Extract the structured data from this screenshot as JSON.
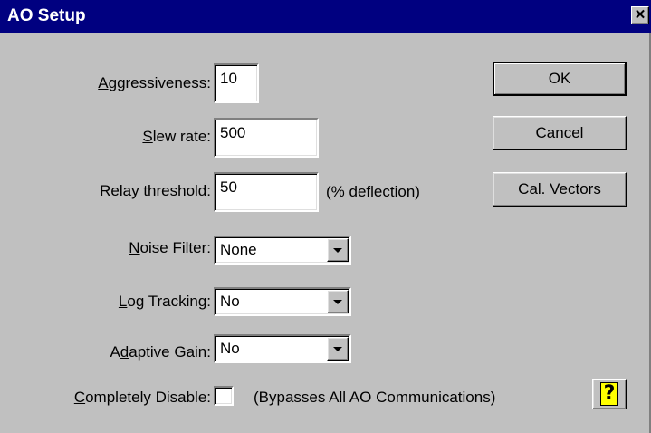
{
  "dialog": {
    "title": "AO Setup",
    "close_glyph": "✕"
  },
  "fields": {
    "aggressiveness": {
      "label_accel": "A",
      "label_rest": "ggressiveness:",
      "value": "10"
    },
    "slew_rate": {
      "label_accel": "S",
      "label_rest": "lew rate:",
      "value": "500"
    },
    "relay_threshold": {
      "label_accel": "R",
      "label_rest": "elay threshold:",
      "value": "50",
      "unit_note": "(% deflection)"
    },
    "noise_filter": {
      "label_accel": "N",
      "label_rest": "oise Filter:",
      "value": "None"
    },
    "log_tracking": {
      "label_accel": "L",
      "label_rest": "og Tracking:",
      "value": "No"
    },
    "adaptive_gain": {
      "label_pre": "A",
      "label_accel": "d",
      "label_rest": "aptive Gain:",
      "value": "No"
    },
    "completely_disable": {
      "label_accel": "C",
      "label_rest": "ompletely Disable:",
      "checked": false,
      "note": "(Bypasses All AO Communications)"
    }
  },
  "buttons": {
    "ok": "OK",
    "cancel": "Cancel",
    "cal_vectors": "Cal. Vectors",
    "help_icon": "question-mark-icon",
    "help_glyph": "?"
  },
  "colors": {
    "titlebar": "#000080",
    "dialog_face": "#c0c0c0",
    "help_highlight": "#ffff00"
  }
}
